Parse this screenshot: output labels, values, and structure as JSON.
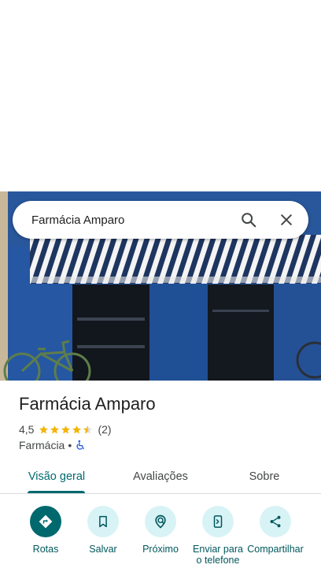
{
  "search": {
    "value": "Farmácia Amparo"
  },
  "place": {
    "title": "Farmácia Amparo",
    "rating": "4,5",
    "review_count": "(2)",
    "category": "Farmácia",
    "separator": "•",
    "star_color": "#f4b400"
  },
  "tabs": [
    {
      "label": "Visão geral",
      "active": true
    },
    {
      "label": "Avaliações",
      "active": false
    },
    {
      "label": "Sobre",
      "active": false
    }
  ],
  "actions": [
    {
      "label": "Rotas",
      "icon": "directions-icon"
    },
    {
      "label": "Salvar",
      "icon": "bookmark-icon"
    },
    {
      "label": "Próximo",
      "icon": "nearby-icon"
    },
    {
      "label": "Enviar para o telefone",
      "icon": "send-to-phone-icon"
    },
    {
      "label": "Compartilhar",
      "icon": "share-icon"
    }
  ],
  "colors": {
    "accent": "#00696e",
    "action_bg": "#d8f3f6"
  }
}
